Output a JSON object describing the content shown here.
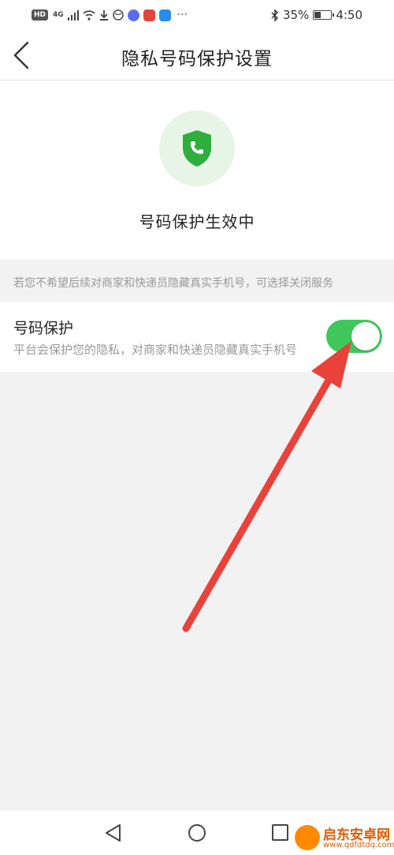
{
  "status_bar": {
    "network": "4G",
    "battery": "35%",
    "battery_level": 0.35,
    "time": "4:50",
    "overflow": "···"
  },
  "header": {
    "title": "隐私号码保护设置"
  },
  "hero": {
    "status_text": "号码保护生效中",
    "icon": "shield-phone-icon",
    "icon_color": "#2fae3e"
  },
  "notice": {
    "text": "若您不希望后续对商家和快递员隐藏真实手机号，可选择关闭服务"
  },
  "setting": {
    "title": "号码保护",
    "description": "平台会保护您的隐私，对商家和快递员隐藏真实手机号",
    "enabled": true,
    "toggle_color": "#3fc75d"
  },
  "annotation": {
    "arrow_color": "#e8423a"
  },
  "watermark": {
    "name": "启东安卓网",
    "url": "www.qdfdtdq.com"
  }
}
